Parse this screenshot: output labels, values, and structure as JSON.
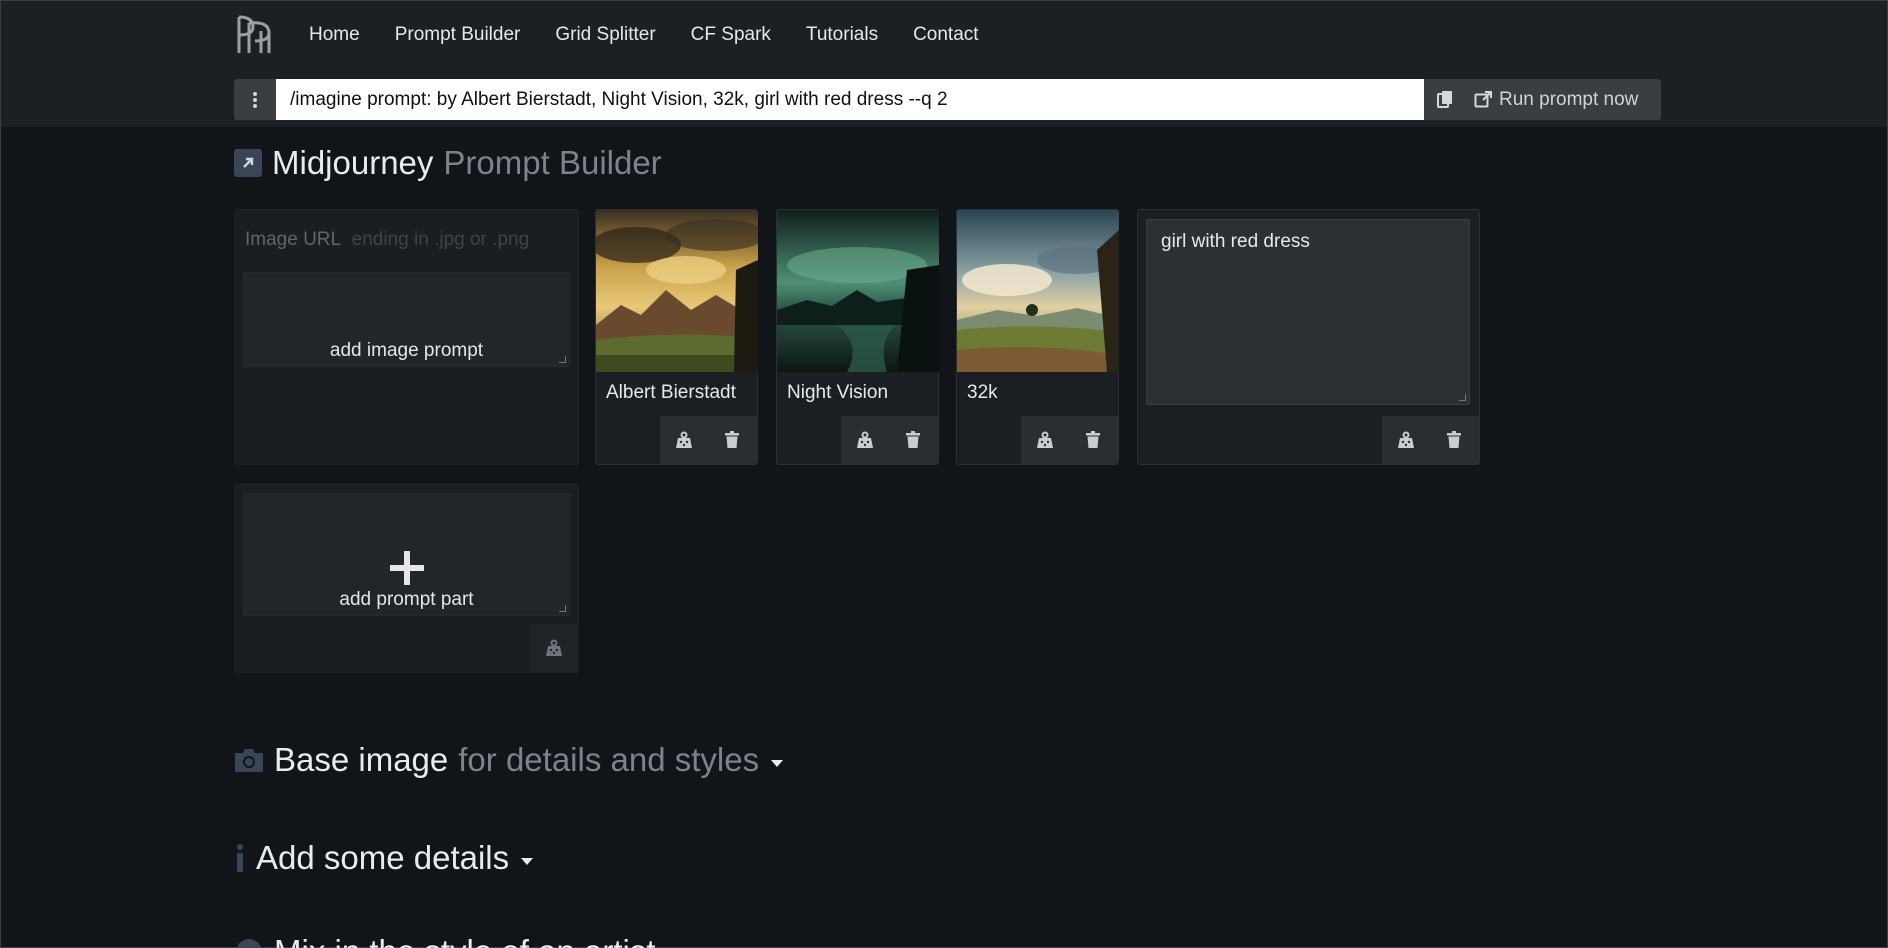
{
  "nav": {
    "items": [
      "Home",
      "Prompt Builder",
      "Grid Splitter",
      "CF Spark",
      "Tutorials",
      "Contact"
    ]
  },
  "command": {
    "value": "/imagine prompt: by Albert Bierstadt, Night Vision, 32k, girl with red dress --q 2",
    "run_label": "Run prompt now"
  },
  "heading": {
    "title": "Midjourney",
    "subtitle": "Prompt Builder"
  },
  "image_prompt": {
    "url_label": "Image URL",
    "url_placeholder": "ending in .jpg or .png",
    "add_label": "add image prompt"
  },
  "parts": [
    {
      "label": "Albert Bierstadt"
    },
    {
      "label": "Night Vision"
    },
    {
      "label": "32k"
    }
  ],
  "text_part": {
    "value": "girl with red dress"
  },
  "add_part": {
    "label": "add prompt part"
  },
  "sections": {
    "base_image": {
      "title": "Base image",
      "subtitle": "for details and styles"
    },
    "details": {
      "title": "Add some details"
    },
    "mix_partial": "Mix in the style of an artist"
  },
  "colors": {
    "background": "#111418",
    "header": "#1c1f24",
    "card": "#1b1e22",
    "button": "#3a3d42"
  }
}
